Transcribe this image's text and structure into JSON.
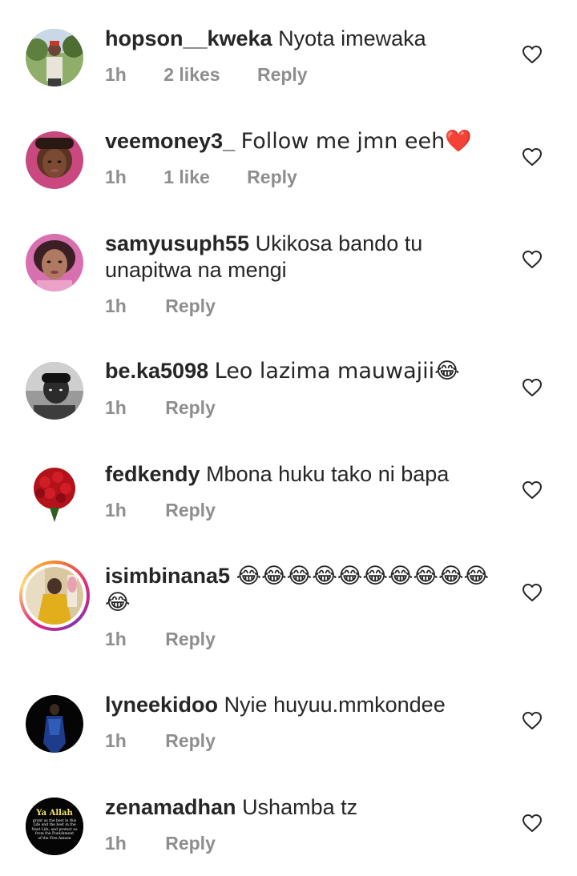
{
  "comments": [
    {
      "username": "hopson__kweka",
      "text": "Nyota imewaka",
      "time": "1h",
      "likes": "2 likes",
      "reply": "Reply"
    },
    {
      "username": "veemoney3_",
      "text": "Follow me jmn eeh❤️",
      "time": "1h",
      "likes": "1 like",
      "reply": "Reply"
    },
    {
      "username": "samyusuph55",
      "text": "Ukikosa bando tu unapitwa na mengi",
      "time": "1h",
      "reply": "Reply"
    },
    {
      "username": "be.ka5098",
      "text": "Leo lazima mauwajii😂",
      "time": "1h",
      "reply": "Reply"
    },
    {
      "username": "fedkendy",
      "text": "Mbona huku tako ni bapa",
      "time": "1h",
      "reply": "Reply"
    },
    {
      "username": "isimbinana5",
      "text": "😂😂😂😂😂😂😂😂😂😂😂",
      "time": "1h",
      "reply": "Reply"
    },
    {
      "username": "lyneekidoo",
      "text": "Nyie huyuu.mmkondee",
      "time": "1h",
      "reply": "Reply"
    },
    {
      "username": "zenamadhan",
      "text": "Ushamba tz",
      "time": "1h",
      "reply": "Reply"
    }
  ],
  "avatar_caption": {
    "title": "Ya Allah",
    "body_lines": [
      "grant us the best in this",
      "Life and the best in the",
      "Next Life, and protect us",
      "from the Punishment",
      "of the Fire.Ameen"
    ]
  },
  "colors": {
    "text": "#262626",
    "secondary": "#8e8e8e",
    "story_ring": "#dd2a7b"
  },
  "icons": {
    "like": "heart-outline-icon"
  }
}
